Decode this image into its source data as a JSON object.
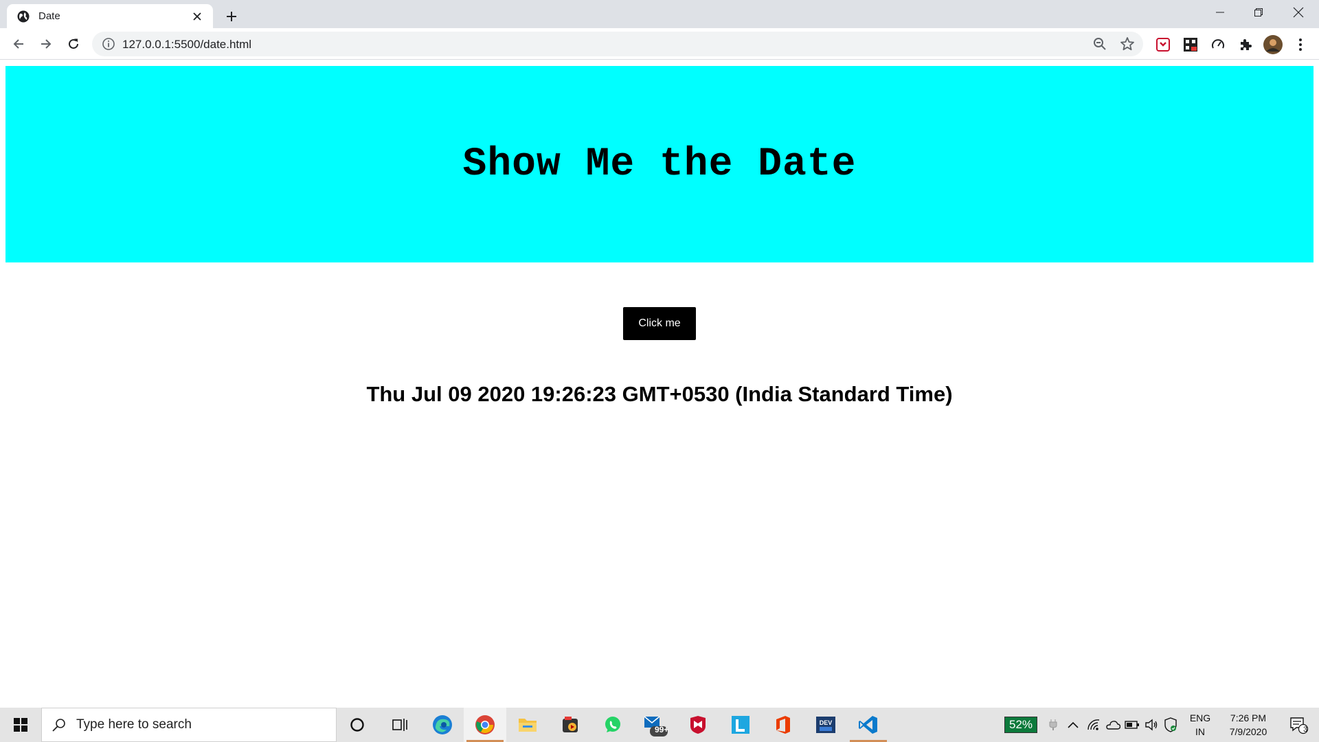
{
  "browser": {
    "tab_title": "Date",
    "url": "127.0.0.1:5500/date.html"
  },
  "page": {
    "heading": "Show Me the Date",
    "button_label": "Click me",
    "date_text": "Thu Jul 09 2020 19:26:23 GMT+0530 (India Standard Time)"
  },
  "taskbar": {
    "search_placeholder": "Type here to search",
    "mail_badge": "99+",
    "battery_percent": "52%",
    "lang_primary": "ENG",
    "lang_secondary": "IN",
    "time": "7:26 PM",
    "date": "7/9/2020",
    "notifications_count": "3"
  },
  "colors": {
    "banner_bg": "#00ffff",
    "button_bg": "#000000",
    "button_text": "#ffffff"
  }
}
